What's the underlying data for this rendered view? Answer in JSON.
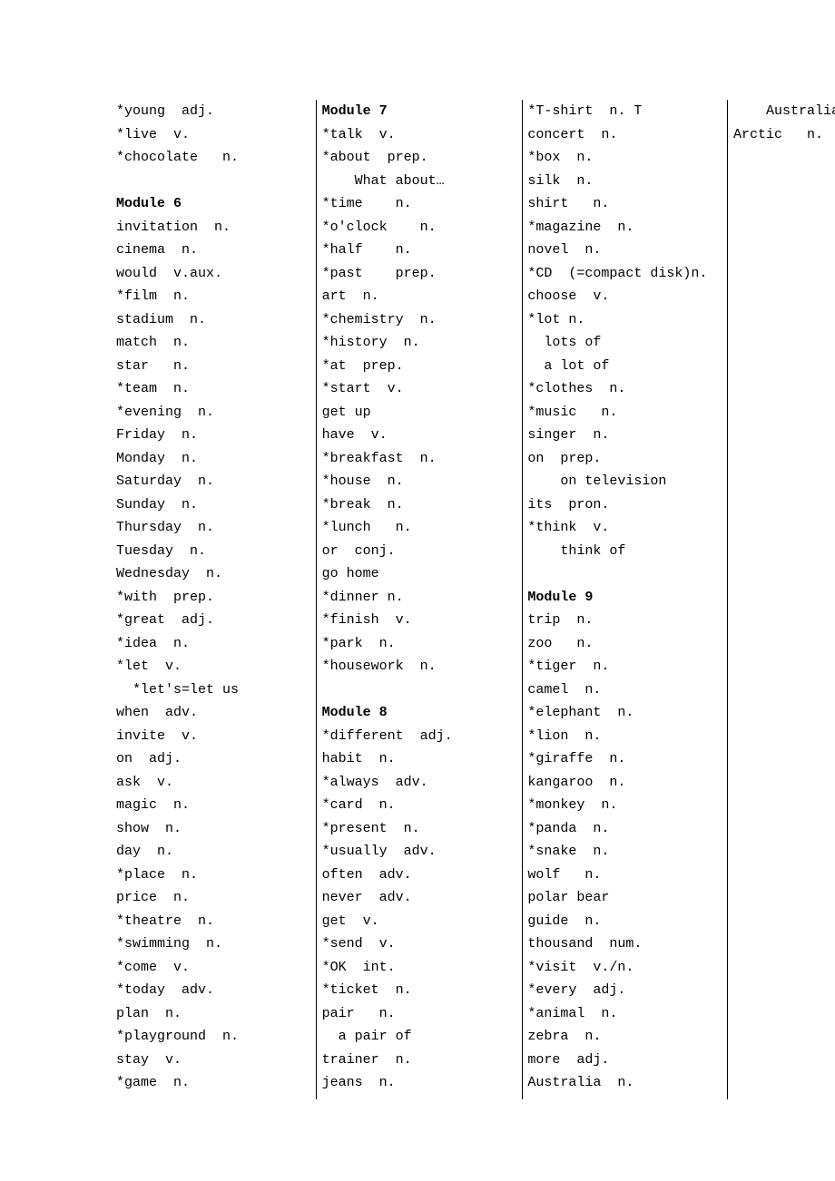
{
  "columns": [
    [
      {
        "t": "entry",
        "text": "*young  adj."
      },
      {
        "t": "entry",
        "text": "*live  v."
      },
      {
        "t": "entry",
        "text": "*chocolate   n."
      },
      {
        "t": "blank"
      },
      {
        "t": "heading",
        "text": "Module 6"
      },
      {
        "t": "entry",
        "text": "invitation  n."
      },
      {
        "t": "entry",
        "text": "cinema  n."
      },
      {
        "t": "entry",
        "text": "would  v.aux."
      },
      {
        "t": "entry",
        "text": "*film  n."
      },
      {
        "t": "entry",
        "text": "stadium  n."
      },
      {
        "t": "entry",
        "text": "match  n."
      },
      {
        "t": "entry",
        "text": "star   n."
      },
      {
        "t": "entry",
        "text": "*team  n."
      },
      {
        "t": "entry",
        "text": "*evening  n."
      },
      {
        "t": "entry",
        "text": "Friday  n."
      },
      {
        "t": "entry",
        "text": "Monday  n."
      },
      {
        "t": "entry",
        "text": "Saturday  n."
      },
      {
        "t": "entry",
        "text": "Sunday  n."
      },
      {
        "t": "entry",
        "text": "Thursday  n."
      },
      {
        "t": "entry",
        "text": "Tuesday  n."
      },
      {
        "t": "entry",
        "text": "Wednesday  n."
      },
      {
        "t": "entry",
        "text": "*with  prep."
      },
      {
        "t": "entry",
        "text": "*great  adj."
      },
      {
        "t": "entry",
        "text": "*idea  n."
      },
      {
        "t": "entry",
        "text": "*let  v."
      },
      {
        "t": "entry",
        "text": "  *let's=let us"
      },
      {
        "t": "entry",
        "text": "when  adv."
      },
      {
        "t": "entry",
        "text": "invite  v."
      },
      {
        "t": "entry",
        "text": "on  adj."
      },
      {
        "t": "entry",
        "text": "ask  v."
      },
      {
        "t": "entry",
        "text": "magic  n."
      },
      {
        "t": "entry",
        "text": "show  n."
      },
      {
        "t": "entry",
        "text": "day  n."
      },
      {
        "t": "entry",
        "text": "*place  n."
      },
      {
        "t": "entry",
        "text": "price  n."
      },
      {
        "t": "entry",
        "text": "*theatre  n."
      },
      {
        "t": "entry",
        "text": "*swimming  n."
      },
      {
        "t": "entry",
        "text": "*come  v."
      },
      {
        "t": "entry",
        "text": "*today  adv."
      },
      {
        "t": "entry",
        "text": "plan  n."
      },
      {
        "t": "entry",
        "text": "*playground  n."
      },
      {
        "t": "entry",
        "text": "stay  v."
      },
      {
        "t": "entry",
        "text": "*game  n."
      }
    ],
    [
      {
        "t": "heading",
        "text": "Module 7"
      },
      {
        "t": "entry",
        "text": "*talk  v."
      },
      {
        "t": "entry",
        "text": "*about  prep."
      },
      {
        "t": "entry",
        "text": "    What about…"
      },
      {
        "t": "entry",
        "text": "*time    n."
      },
      {
        "t": "entry",
        "text": "*o'clock    n."
      },
      {
        "t": "entry",
        "text": "*half    n."
      },
      {
        "t": "entry",
        "text": "*past    prep."
      },
      {
        "t": "entry",
        "text": "art  n."
      },
      {
        "t": "entry",
        "text": "*chemistry  n."
      },
      {
        "t": "entry",
        "text": "*history  n."
      },
      {
        "t": "entry",
        "text": "*at  prep."
      },
      {
        "t": "entry",
        "text": "*start  v."
      },
      {
        "t": "entry",
        "text": "get up"
      },
      {
        "t": "entry",
        "text": "have  v."
      },
      {
        "t": "entry",
        "text": "*breakfast  n."
      },
      {
        "t": "entry",
        "text": "*house  n."
      },
      {
        "t": "entry",
        "text": "*break  n."
      },
      {
        "t": "entry",
        "text": "*lunch   n."
      },
      {
        "t": "entry",
        "text": "or  conj."
      },
      {
        "t": "entry",
        "text": "go home"
      },
      {
        "t": "entry",
        "text": "*dinner n."
      },
      {
        "t": "entry",
        "text": "*finish  v."
      },
      {
        "t": "entry",
        "text": "*park  n."
      },
      {
        "t": "entry",
        "text": "*housework  n."
      },
      {
        "t": "blank"
      },
      {
        "t": "heading",
        "text": "Module 8"
      },
      {
        "t": "entry",
        "text": "*different  adj."
      },
      {
        "t": "entry",
        "text": "habit  n."
      },
      {
        "t": "entry",
        "text": "*always  adv."
      },
      {
        "t": "entry",
        "text": "*card  n."
      },
      {
        "t": "entry",
        "text": "*present  n."
      },
      {
        "t": "entry",
        "text": "*usually  adv."
      },
      {
        "t": "entry",
        "text": "often  adv."
      },
      {
        "t": "entry",
        "text": "never  adv."
      },
      {
        "t": "entry",
        "text": "get  v."
      },
      {
        "t": "entry",
        "text": "*send  v."
      },
      {
        "t": "entry",
        "text": "*OK  int."
      },
      {
        "t": "entry",
        "text": "*ticket  n."
      },
      {
        "t": "entry",
        "text": "pair   n."
      },
      {
        "t": "entry",
        "text": "  a pair of"
      },
      {
        "t": "entry",
        "text": "trainer  n."
      },
      {
        "t": "entry",
        "text": "jeans  n."
      },
      {
        "t": "entry",
        "text": "*T-shirt  n. T"
      }
    ],
    [
      {
        "t": "entry",
        "text": "concert  n."
      },
      {
        "t": "entry",
        "text": "*box  n."
      },
      {
        "t": "entry",
        "text": "silk  n."
      },
      {
        "t": "entry",
        "text": "shirt   n."
      },
      {
        "t": "entry",
        "text": "*magazine  n."
      },
      {
        "t": "entry",
        "text": "novel  n."
      },
      {
        "t": "entry",
        "text": "*CD  (=compact disk)n."
      },
      {
        "t": "entry",
        "text": "choose  v."
      },
      {
        "t": "entry",
        "text": "*lot n."
      },
      {
        "t": "entry",
        "text": "  lots of"
      },
      {
        "t": "entry",
        "text": "  a lot of"
      },
      {
        "t": "entry",
        "text": "*clothes  n."
      },
      {
        "t": "entry",
        "text": "*music   n."
      },
      {
        "t": "entry",
        "text": "singer  n."
      },
      {
        "t": "entry",
        "text": "on  prep."
      },
      {
        "t": "entry",
        "text": "    on television"
      },
      {
        "t": "entry",
        "text": "its  pron."
      },
      {
        "t": "entry",
        "text": "*think  v."
      },
      {
        "t": "entry",
        "text": "    think of"
      },
      {
        "t": "blank"
      },
      {
        "t": "heading",
        "text": "Module 9"
      },
      {
        "t": "entry",
        "text": "trip  n."
      },
      {
        "t": "entry",
        "text": "zoo   n."
      },
      {
        "t": "entry",
        "text": "*tiger  n."
      },
      {
        "t": "entry",
        "text": "camel  n."
      },
      {
        "t": "entry",
        "text": "*elephant  n."
      },
      {
        "t": "entry",
        "text": "*lion  n."
      },
      {
        "t": "entry",
        "text": "*giraffe  n."
      },
      {
        "t": "entry",
        "text": "kangaroo  n."
      },
      {
        "t": "entry",
        "text": "*monkey  n."
      },
      {
        "t": "entry",
        "text": "*panda  n."
      },
      {
        "t": "entry",
        "text": "*snake  n."
      },
      {
        "t": "entry",
        "text": "wolf   n."
      },
      {
        "t": "entry",
        "text": "polar bear"
      },
      {
        "t": "entry",
        "text": "guide  n."
      },
      {
        "t": "entry",
        "text": "thousand  num."
      },
      {
        "t": "entry",
        "text": "*visit  v./n."
      },
      {
        "t": "entry",
        "text": "*every  adj."
      },
      {
        "t": "entry",
        "text": "*animal  n."
      },
      {
        "t": "entry",
        "text": "zebra  n."
      },
      {
        "t": "entry",
        "text": "more  adj."
      },
      {
        "t": "entry",
        "text": "Australia  n."
      },
      {
        "t": "entry",
        "text": "    Australian  adj."
      },
      {
        "t": "entry",
        "text": "Arctic   n."
      }
    ]
  ]
}
